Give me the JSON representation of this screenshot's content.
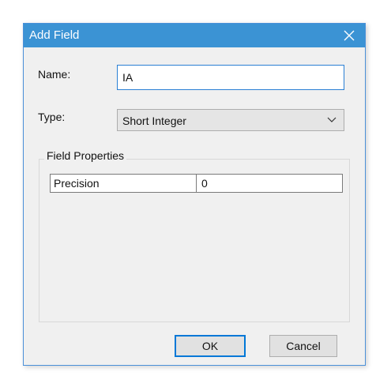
{
  "dialog": {
    "title": "Add Field",
    "close_icon": "close-icon"
  },
  "name_field": {
    "label": "Name:",
    "value": "IA"
  },
  "type_field": {
    "label": "Type:",
    "selected": "Short Integer",
    "dropdown_icon": "chevron-down-icon"
  },
  "field_properties": {
    "label": "Field Properties",
    "rows": [
      {
        "property": "Precision",
        "value": "0"
      }
    ]
  },
  "buttons": {
    "ok_label": "OK",
    "cancel_label": "Cancel"
  },
  "colors": {
    "titlebar": "#3b93d4",
    "dialog_background": "#f0f0f0",
    "focus_border": "#0078d7"
  }
}
